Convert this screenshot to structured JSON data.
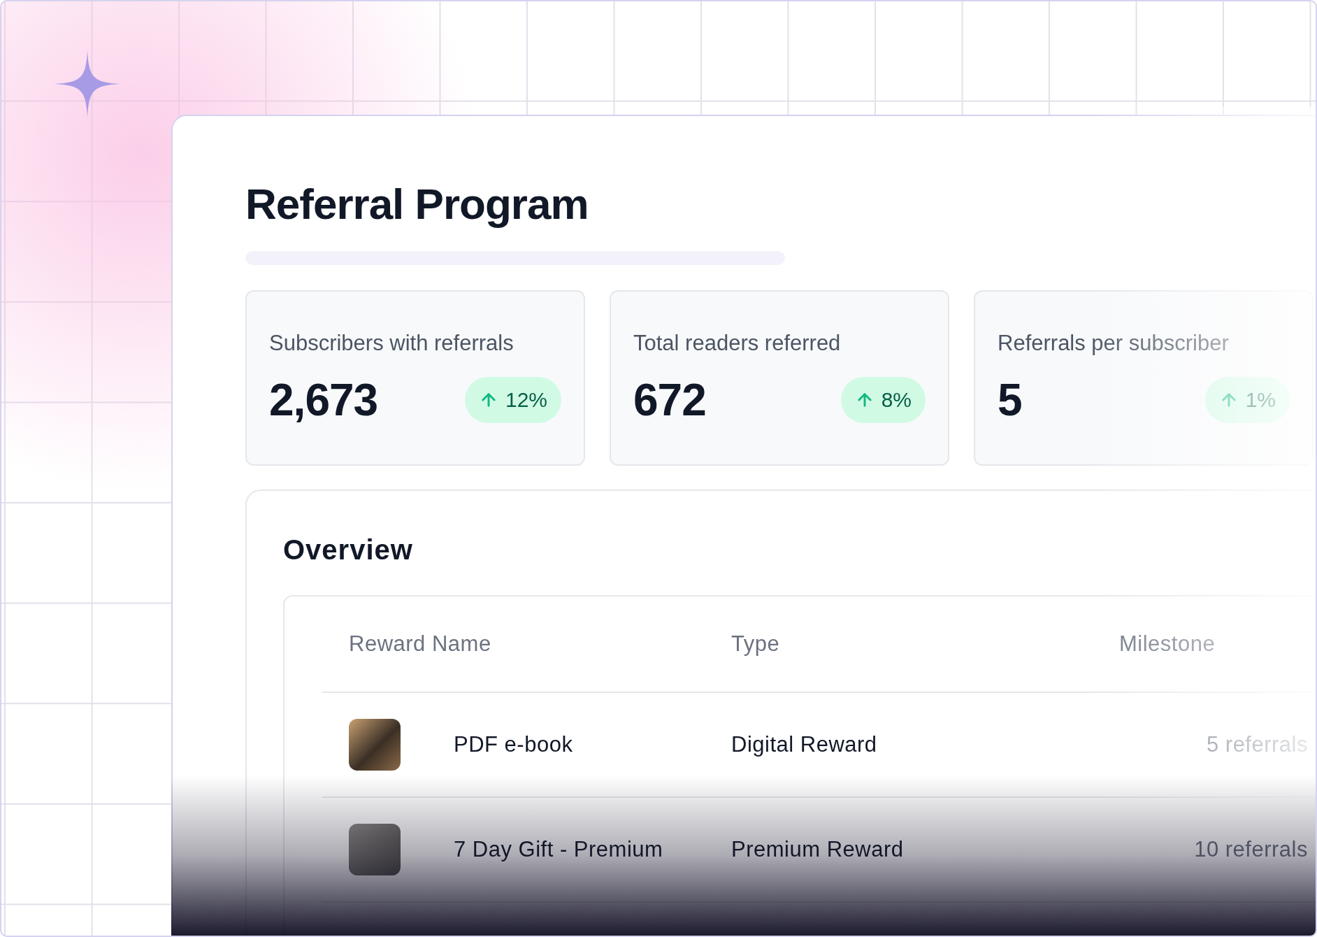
{
  "title": "Referral Program",
  "stats": [
    {
      "label": "Subscribers with referrals",
      "value": "2,673",
      "change": "12%"
    },
    {
      "label": "Total readers referred",
      "value": "672",
      "change": "8%"
    },
    {
      "label": "Referrals per subscriber",
      "value": "5",
      "change": "1%"
    }
  ],
  "overview": {
    "title": "Overview",
    "columns": [
      "Reward Name",
      "Type",
      "Milestone"
    ],
    "rows": [
      {
        "name": "PDF e-book",
        "type": "Digital Reward",
        "milestone": "5 referrals"
      },
      {
        "name": "7 Day Gift - Premium",
        "type": "Premium Reward",
        "milestone": "10 referrals"
      }
    ]
  }
}
